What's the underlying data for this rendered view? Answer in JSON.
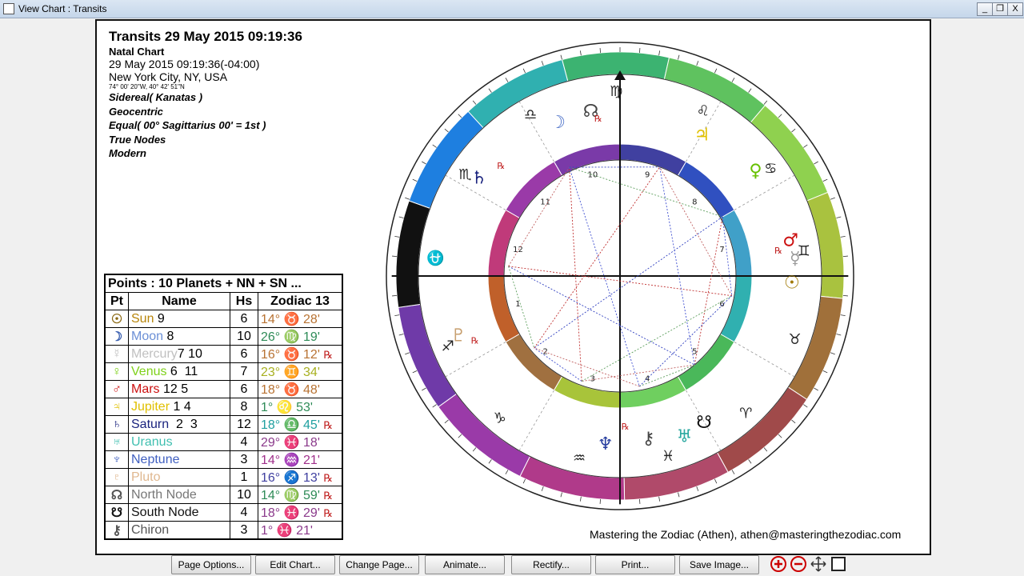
{
  "window": {
    "title": "View Chart : Transits",
    "min_label": "_",
    "max_label": "❐",
    "close_label": "X"
  },
  "header": {
    "title": "Transits 29 May 2015 09:19:36",
    "subtitle": "Natal Chart",
    "datetime": "29 May 2015 09:19:36(-04:00)",
    "place": "New York City, NY, USA",
    "coords": "74° 00' 20\"W, 40° 42' 51\"N",
    "settings": [
      "Sidereal( Kanatas )",
      "Geocentric",
      "Equal( 00° Sagittarius 00' = 1st )",
      "True Nodes",
      "Modern"
    ]
  },
  "points_table": {
    "caption": "Points : 10 Planets + NN + SN ...",
    "headers": [
      "Pt",
      "Name",
      "Hs",
      "Zodiac 13"
    ],
    "rows": [
      {
        "glyph": "☉",
        "name": "Sun",
        "suffix": " 9",
        "hs": "6",
        "deg": "14°",
        "sign": "♉",
        "min": "28'",
        "rx": "",
        "color": "#b8860b",
        "gcolor": "#8b6914",
        "scolor": "#b87333"
      },
      {
        "glyph": "☽",
        "name": "Moon",
        "suffix": " 8",
        "hs": "10",
        "deg": "26°",
        "sign": "♍",
        "min": "19'",
        "rx": "",
        "color": "#6b8fd6",
        "gcolor": "#3a5fb0",
        "scolor": "#2e8b57"
      },
      {
        "glyph": "☿",
        "name": "Mercury",
        "suffix": "7 10",
        "hs": "6",
        "deg": "16°",
        "sign": "♉",
        "min": "12'",
        "rx": "℞",
        "color": "#c0c0c0",
        "gcolor": "#c0c0c0",
        "scolor": "#b87333"
      },
      {
        "glyph": "♀",
        "name": "Venus",
        "suffix": " 6  11",
        "hs": "7",
        "deg": "23°",
        "sign": "♊",
        "min": "34'",
        "rx": "",
        "color": "#7fd11a",
        "gcolor": "#7fd11a",
        "scolor": "#a8b020"
      },
      {
        "glyph": "♂",
        "name": "Mars",
        "suffix": " 12 5",
        "hs": "6",
        "deg": "18°",
        "sign": "♉",
        "min": "48'",
        "rx": "",
        "color": "#cc1111",
        "gcolor": "#cc1111",
        "scolor": "#b87333"
      },
      {
        "glyph": "♃",
        "name": "Jupiter",
        "suffix": " 1 4",
        "hs": "8",
        "deg": "1°",
        "sign": "♌",
        "min": "53'",
        "rx": "",
        "color": "#e0c000",
        "gcolor": "#e0c000",
        "scolor": "#2e8b57"
      },
      {
        "glyph": "♄",
        "name": "Saturn",
        "suffix": "  2  3",
        "hs": "12",
        "deg": "18°",
        "sign": "♎",
        "min": "45'",
        "rx": "℞",
        "color": "#1a237e",
        "gcolor": "#1a237e",
        "scolor": "#20a0a0"
      },
      {
        "glyph": "♅",
        "name": "Uranus",
        "suffix": "",
        "hs": "4",
        "deg": "29°",
        "sign": "♓",
        "min": "18'",
        "rx": "",
        "color": "#3fbfb0",
        "gcolor": "#3fbfb0",
        "scolor": "#8b3a8b"
      },
      {
        "glyph": "♆",
        "name": "Neptune",
        "suffix": "",
        "hs": "3",
        "deg": "14°",
        "sign": "♒",
        "min": "21'",
        "rx": "",
        "color": "#4060c0",
        "gcolor": "#4060c0",
        "scolor": "#a0308b"
      },
      {
        "glyph": "♇",
        "name": "Pluto",
        "suffix": "",
        "hs": "1",
        "deg": "16°",
        "sign": "♐",
        "min": "13'",
        "rx": "℞",
        "color": "#e0b890",
        "gcolor": "#e0b890",
        "scolor": "#4040a0"
      },
      {
        "glyph": "☊",
        "name": "North Node",
        "suffix": "",
        "hs": "10",
        "deg": "14°",
        "sign": "♍",
        "min": "59'",
        "rx": "℞",
        "color": "#777",
        "gcolor": "#555",
        "scolor": "#2e8b57"
      },
      {
        "glyph": "☋",
        "name": "South Node",
        "suffix": "",
        "hs": "4",
        "deg": "18°",
        "sign": "♓",
        "min": "29'",
        "rx": "℞",
        "color": "#111",
        "gcolor": "#111",
        "scolor": "#8b3a8b"
      },
      {
        "glyph": "⚷",
        "name": "Chiron",
        "suffix": "",
        "hs": "3",
        "deg": "1°",
        "sign": "♓",
        "min": "21'",
        "rx": "",
        "color": "#555",
        "gcolor": "#555",
        "scolor": "#8b3a8b"
      }
    ]
  },
  "wheel": {
    "house_numbers": [
      "1",
      "2",
      "3",
      "4",
      "5",
      "6",
      "7",
      "8",
      "9",
      "10",
      "11",
      "12"
    ],
    "signs": [
      {
        "glyph": "♍",
        "color": "#3cb371"
      },
      {
        "glyph": "♌",
        "color": "#5fc25f"
      },
      {
        "glyph": "♋",
        "color": "#8fd14f"
      },
      {
        "glyph": "♊",
        "color": "#a9c23f"
      },
      {
        "glyph": "♉",
        "color": "#a0703a"
      },
      {
        "glyph": "♈",
        "color": "#a04a4a"
      },
      {
        "glyph": "♓",
        "color": "#b04a6a"
      },
      {
        "glyph": "♒",
        "color": "#b03a8a"
      },
      {
        "glyph": "♑",
        "color": "#9a3aa8"
      },
      {
        "glyph": "♐",
        "color": "#6f3aa8"
      },
      {
        "glyph": "⛎",
        "color": "#111111"
      },
      {
        "glyph": "♏",
        "color": "#1e7fe0"
      },
      {
        "glyph": "♎",
        "color": "#30b0b0"
      }
    ],
    "planets_glyphs": [
      {
        "g": "☽",
        "c": "#4a6fc8"
      },
      {
        "g": "☊",
        "c": "#444"
      },
      {
        "g": "♃",
        "c": "#e0c000"
      },
      {
        "g": "♀",
        "c": "#66c000"
      },
      {
        "g": "♂",
        "c": "#cc1111"
      },
      {
        "g": "☿",
        "c": "#999"
      },
      {
        "g": "☉",
        "c": "#a07800"
      },
      {
        "g": "☋",
        "c": "#111"
      },
      {
        "g": "♅",
        "c": "#2aa8a0"
      },
      {
        "g": "⚷",
        "c": "#444"
      },
      {
        "g": "♆",
        "c": "#2a40a0"
      },
      {
        "g": "♇",
        "c": "#c8a070"
      },
      {
        "g": "♄",
        "c": "#1a237e"
      }
    ],
    "retro_mark": "℞"
  },
  "footer": "Mastering the Zodiac (Athen), athen@masteringthezodiac.com",
  "toolbar": {
    "buttons": [
      "Page Options...",
      "Edit Chart...",
      "Change Page...",
      "Animate...",
      "Rectify...",
      "Print...",
      "Save Image..."
    ]
  }
}
